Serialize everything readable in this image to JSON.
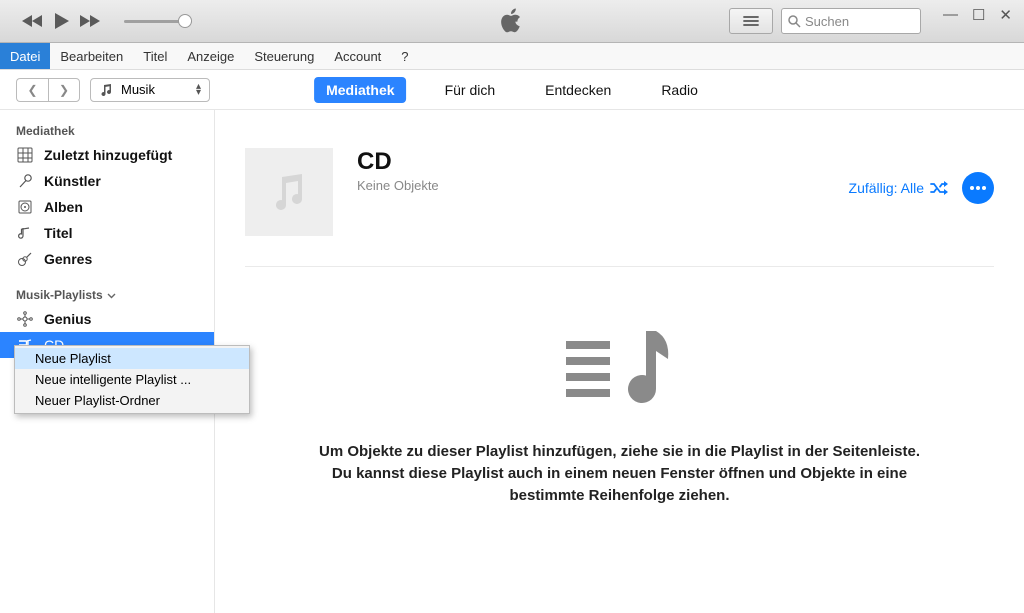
{
  "search": {
    "placeholder": "Suchen"
  },
  "menu": {
    "file": "Datei",
    "edit": "Bearbeiten",
    "title": "Titel",
    "view": "Anzeige",
    "controls": "Steuerung",
    "account": "Account",
    "help": "?"
  },
  "toolbar": {
    "media_label": "Musik",
    "tabs": {
      "library": "Mediathek",
      "foryou": "Für dich",
      "discover": "Entdecken",
      "radio": "Radio"
    }
  },
  "sidebar": {
    "section_library": "Mediathek",
    "items_library": {
      "recent": "Zuletzt hinzugefügt",
      "artists": "Künstler",
      "albums": "Alben",
      "titles": "Titel",
      "genres": "Genres"
    },
    "section_playlists": "Musik-Playlists",
    "items_playlists": {
      "genius": "Genius",
      "cd": "CD"
    }
  },
  "content": {
    "playlist_title": "CD",
    "playlist_sub": "Keine Objekte",
    "shuffle_label": "Zufällig: Alle",
    "empty_text": "Um Objekte zu dieser Playlist hinzufügen, ziehe sie in die Playlist in der Seitenleiste. Du kannst diese Playlist auch in einem neuen Fenster öffnen und Objekte in eine bestimmte Reihenfolge ziehen."
  },
  "context_menu": {
    "new_playlist": "Neue Playlist",
    "new_smart": "Neue intelligente Playlist ...",
    "new_folder": "Neuer Playlist-Ordner"
  }
}
